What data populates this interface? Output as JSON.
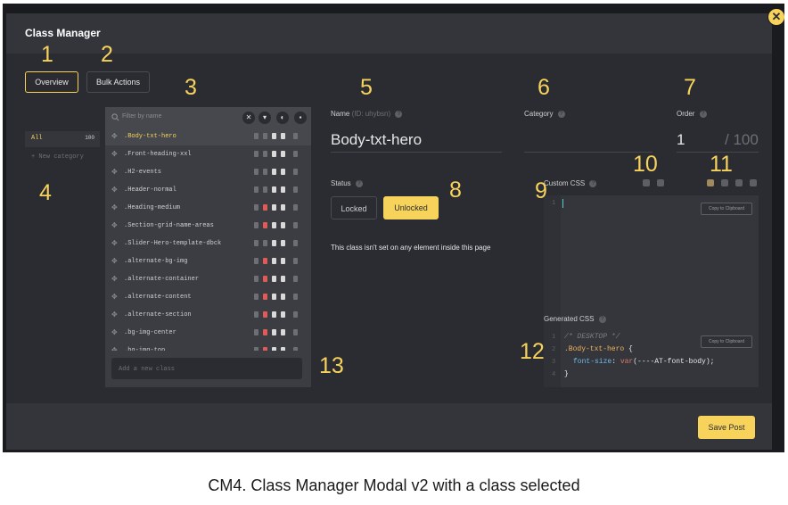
{
  "modal": {
    "title": "Class Manager",
    "close_icon": "close-icon"
  },
  "tabs": [
    {
      "label": "Overview",
      "active": true
    },
    {
      "label": "Bulk Actions",
      "active": false
    }
  ],
  "callouts": [
    "1",
    "2",
    "3",
    "4",
    "5",
    "6",
    "7",
    "8",
    "9",
    "10",
    "11",
    "12",
    "13"
  ],
  "categories": {
    "all_label": "All",
    "all_count": "100",
    "new_category": "+ New category"
  },
  "class_list": {
    "filter_placeholder": "Filter by name",
    "header_icons": [
      "clear-filter-icon",
      "shield-icon",
      "toggle-icon",
      "lock-icon"
    ],
    "items": [
      {
        "name": ".Body-txt-hero",
        "selected": true,
        "locked": false
      },
      {
        "name": ".Front-heading-xxl",
        "selected": false,
        "locked": false
      },
      {
        "name": ".H2-events",
        "selected": false,
        "locked": false
      },
      {
        "name": ".Header-normal",
        "selected": false,
        "locked": false
      },
      {
        "name": ".Heading-medium",
        "selected": false,
        "locked": true
      },
      {
        "name": ".Section-grid-name-areas",
        "selected": false,
        "locked": true
      },
      {
        "name": ".Slider-Hero-template-dbck",
        "selected": false,
        "locked": false
      },
      {
        "name": ".alternate-bg-img",
        "selected": false,
        "locked": true
      },
      {
        "name": ".alternate-container",
        "selected": false,
        "locked": true
      },
      {
        "name": ".alternate-content",
        "selected": false,
        "locked": true
      },
      {
        "name": ".alternate-section",
        "selected": false,
        "locked": true
      },
      {
        "name": ".bg-img-center",
        "selected": false,
        "locked": true
      },
      {
        "name": ".bg-img-top",
        "selected": false,
        "locked": true
      }
    ],
    "new_class_placeholder": "Add a new class"
  },
  "detail": {
    "name_label": "Name",
    "name_id": "(ID: uhybsn)",
    "name_value": "Body-txt-hero",
    "category_label": "Category",
    "order_label": "Order",
    "order_value": "1",
    "order_max": "/ 100",
    "status_label": "Status",
    "status_locked": "Locked",
    "status_unlocked": "Unlocked",
    "status_active": "Unlocked",
    "status_note": "This class isn't set on any element inside this page"
  },
  "custom_css": {
    "label": "Custom CSS",
    "copy_label": "Copy to Clipboard",
    "line_numbers": [
      "1"
    ],
    "toolbar_icons": [
      "preview-icon",
      "reset-icon",
      "desktop-icon",
      "tablet-icon",
      "laptop-icon",
      "mobile-icon"
    ]
  },
  "generated_css": {
    "label": "Generated CSS",
    "copy_label": "Copy to Clipboard",
    "lines": [
      {
        "ln": "1",
        "text": "/* DESKTOP */"
      },
      {
        "ln": "2",
        "selector": ".Body-txt-hero",
        "brace": " {"
      },
      {
        "ln": "3",
        "prop": "font-size",
        "colon": ": ",
        "fn": "var",
        "arg": "(----AT-font-body);"
      },
      {
        "ln": "4",
        "text": "}"
      }
    ]
  },
  "footer": {
    "save_label": "Save Post"
  },
  "caption": "CM4. Class Manager Modal v2 with a class selected",
  "colors": {
    "accent": "#f7d35c",
    "background": "#2a2c31",
    "locked": "#e05a5a"
  }
}
